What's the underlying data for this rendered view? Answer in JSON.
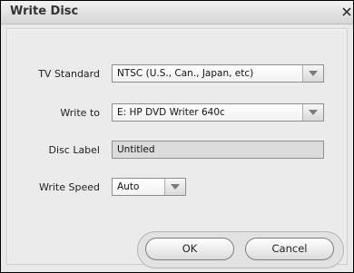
{
  "window": {
    "title": "Write Disc"
  },
  "form": {
    "tv_standard": {
      "label": "TV Standard",
      "value": "NTSC (U.S., Can., Japan, etc)"
    },
    "write_to": {
      "label": "Write to",
      "value": "E: HP DVD Writer 640c"
    },
    "disc_label": {
      "label": "Disc Label",
      "value": "Untitled"
    },
    "write_speed": {
      "label": "Write Speed",
      "value": "Auto"
    }
  },
  "buttons": {
    "ok": "OK",
    "cancel": "Cancel"
  },
  "icons": {
    "close": "close-icon",
    "dropdown": "chevron-down-icon"
  }
}
